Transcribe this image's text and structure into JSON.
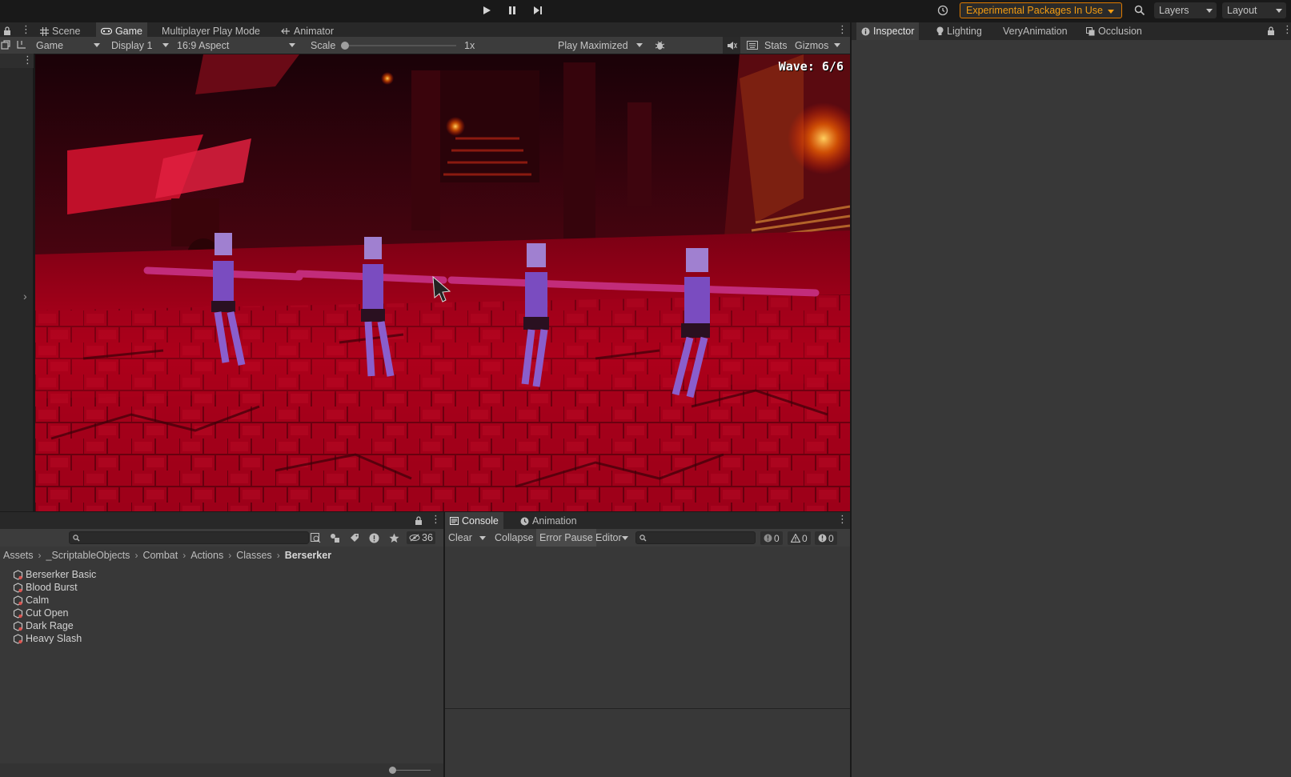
{
  "toolbar": {
    "play_icon": "play-icon",
    "pause_icon": "pause-icon",
    "step_icon": "step-icon",
    "history_icon": "history-icon",
    "experimental_label": "Experimental Packages In Use",
    "search_icon": "search-icon",
    "layers_label": "Layers",
    "layout_label": "Layout"
  },
  "center_tabs": [
    {
      "label": "Scene",
      "icon": "grid-icon"
    },
    {
      "label": "Game",
      "icon": "gamepad-icon"
    },
    {
      "label": "Multiplayer Play Mode",
      "icon": ""
    },
    {
      "label": "Animator",
      "icon": "animator-icon"
    }
  ],
  "game_toolbar": {
    "view_select": "Game",
    "display_select": "Display 1",
    "aspect_select": "16:9 Aspect",
    "scale_label": "Scale",
    "scale_value": "1x",
    "scale_fraction": 0.0,
    "play_mode_select": "Play Maximized",
    "stats_label": "Stats",
    "gizmos_label": "Gizmos"
  },
  "game_view": {
    "wave_text": "Wave: 6/6"
  },
  "inspector_tabs": [
    {
      "label": "Inspector",
      "icon": "info-icon"
    },
    {
      "label": "Lighting",
      "icon": "bulb-icon"
    },
    {
      "label": "VeryAnimation",
      "icon": ""
    },
    {
      "label": "Occlusion",
      "icon": "occlusion-icon"
    }
  ],
  "project": {
    "hidden_count": "36",
    "breadcrumb": [
      "Assets",
      "_ScriptableObjects",
      "Combat",
      "Actions",
      "Classes",
      "Berserker"
    ],
    "items": [
      "Berserker Basic",
      "Blood Burst",
      "Calm",
      "Cut Open",
      "Dark Rage",
      "Heavy Slash"
    ],
    "zoom_fraction": 0.0
  },
  "console": {
    "tabs": [
      {
        "label": "Console",
        "icon": "console-icon"
      },
      {
        "label": "Animation",
        "icon": "clock-icon"
      }
    ],
    "clear_label": "Clear",
    "collapse_label": "Collapse",
    "error_pause_label": "Error Pause",
    "editor_label": "Editor",
    "log_count": "0",
    "warn_count": "0",
    "error_count": "0"
  },
  "colors": {
    "accent_orange": "#f39c12",
    "panel_bg": "#383838",
    "tabbar_bg": "#282828",
    "toolbar_bg": "#191919"
  }
}
